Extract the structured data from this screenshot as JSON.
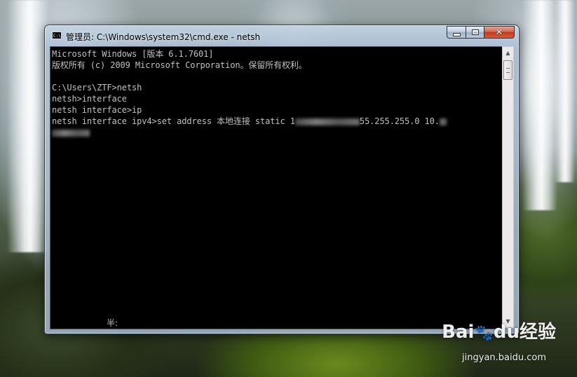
{
  "window": {
    "title": "管理员: C:\\Windows\\system32\\cmd.exe - netsh",
    "icon": "cmd-icon",
    "controls": {
      "minimize_icon": "minimize-icon",
      "maximize_icon": "maximize-icon",
      "close_symbol": "✕"
    }
  },
  "console": {
    "lines": [
      "Microsoft Windows [版本 6.1.7601]",
      "版权所有 (c) 2009 Microsoft Corporation。保留所有权利。",
      "",
      "C:\\Users\\ZTF>netsh",
      "netsh>interface",
      "netsh interface>ip"
    ],
    "command_prefix": "netsh interface ipv4>set address 本地连接 static 1",
    "command_mask_part": "55.255.255.0 10.",
    "ime_status": "半:"
  },
  "scrollbar": {
    "up_symbol": "▲",
    "down_symbol": "▼"
  },
  "watermark": {
    "brand": "Bai",
    "brand_mid": "du",
    "brand_tail": "经验",
    "url": "jingyan.baidu.com"
  },
  "colors": {
    "console_bg": "#000000",
    "console_text": "#c0c0c0",
    "close_button": "#c0391d"
  }
}
